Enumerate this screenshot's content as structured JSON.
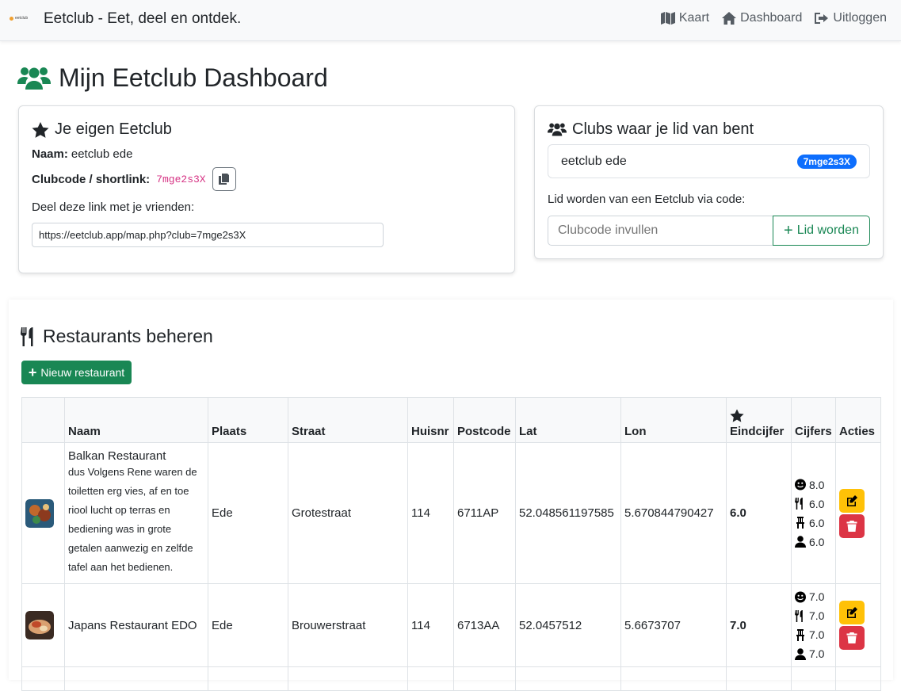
{
  "nav": {
    "brand_title": "Eetclub - Eet, deel en ontdek.",
    "logo_text": "eetclub",
    "links": [
      {
        "label": "Kaart",
        "icon": "map-icon"
      },
      {
        "label": "Dashboard",
        "icon": "home-icon"
      },
      {
        "label": "Uitloggen",
        "icon": "sign-out-icon"
      }
    ]
  },
  "page": {
    "title": "Mijn Eetclub Dashboard",
    "title_icon": "users-icon",
    "accent": "#198754"
  },
  "own_club": {
    "title": "Je eigen Eetclub",
    "name_label": "Naam:",
    "name_value": "eetclub ede",
    "code_label": "Clubcode / shortlink:",
    "code_value": "7mge2s3X",
    "share_label": "Deel deze link met je vrienden:",
    "share_link": "https://eetclub.app/map.php?club=7mge2s3X"
  },
  "member_clubs": {
    "title": "Clubs waar je lid van bent",
    "clubs": [
      {
        "name": "eetclub ede",
        "code": "7mge2s3X"
      }
    ],
    "join_label": "Lid worden van een Eetclub via code:",
    "join_placeholder": "Clubcode invullen",
    "join_button": "Lid worden"
  },
  "restaurants": {
    "title": "Restaurants beheren",
    "new_button": "Nieuw restaurant",
    "columns": [
      "",
      "Naam",
      "Plaats",
      "Straat",
      "Huisnr",
      "Postcode",
      "Lat",
      "Lon",
      "Eindcijfer",
      "Cijfers",
      "Acties"
    ],
    "rows": [
      {
        "name": "Balkan Restaurant",
        "description": "dus Volgens Rene waren de toiletten erg vies, af en toe riool lucht op terras en bediening was in grote getalen aanwezig en zelfde tafel aan het bedienen.",
        "place": "Ede",
        "street": "Grotestraat",
        "number": "114",
        "postcode": "6711AP",
        "lat": "52.048561197585",
        "lon": "5.670844790427",
        "final": "6.0",
        "scores": [
          "8.0",
          "6.0",
          "6.0",
          "6.0"
        ]
      },
      {
        "name": "Japans Restaurant EDO",
        "description": "",
        "place": "Ede",
        "street": "Brouwerstraat",
        "number": "114",
        "postcode": "6713AA",
        "lat": "52.0457512",
        "lon": "5.6673707",
        "final": "7.0",
        "scores": [
          "7.0",
          "7.0",
          "7.0",
          "7.0"
        ]
      }
    ]
  },
  "colors": {
    "success": "#198754",
    "primary": "#0d6efd",
    "warning": "#ffc107",
    "danger": "#dc3545",
    "pink_code": "#d63384"
  }
}
